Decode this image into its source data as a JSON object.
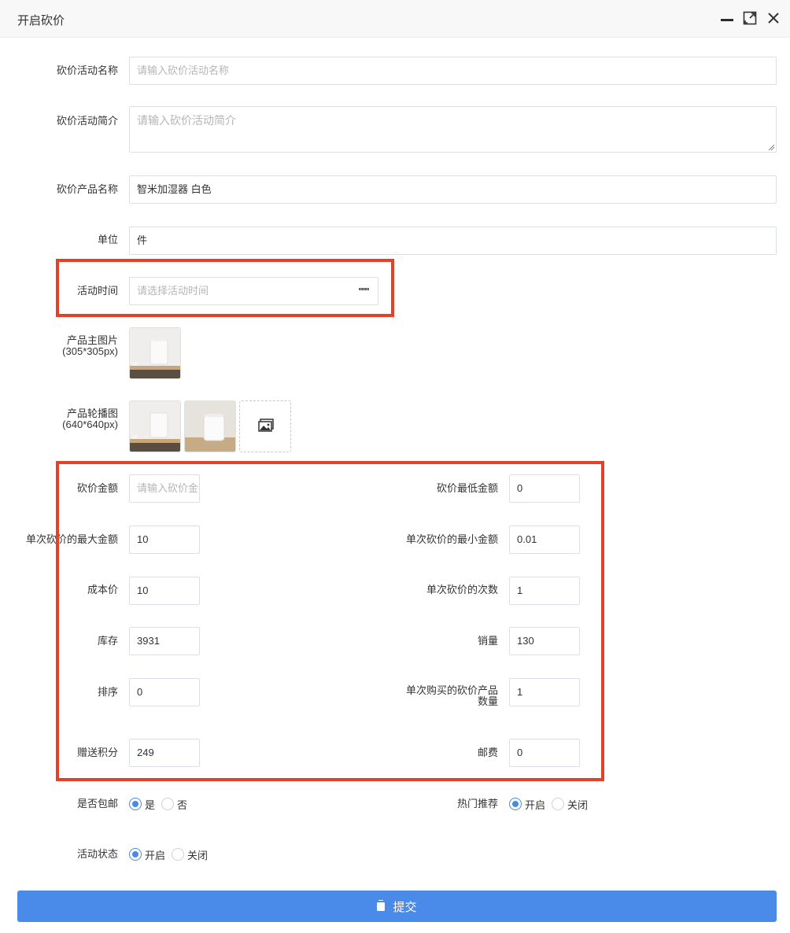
{
  "window": {
    "title": "开启砍价"
  },
  "form": {
    "activity_name": {
      "label": "砍价活动名称",
      "placeholder": "请输入砍价活动名称",
      "value": ""
    },
    "activity_intro": {
      "label": "砍价活动简介",
      "placeholder": "请输入砍价活动简介",
      "value": ""
    },
    "product_name": {
      "label": "砍价产品名称",
      "value": "智米加湿器 白色"
    },
    "unit": {
      "label": "单位",
      "value": "件"
    },
    "activity_time": {
      "label": "活动时间",
      "placeholder": "请选择活动时间",
      "icon": "dots-icon"
    },
    "main_image": {
      "label": "产品主图片",
      "sub_label": "(305*305px)"
    },
    "carousel": {
      "label": "产品轮播图",
      "sub_label": "(640*640px)"
    },
    "bargain_amount": {
      "label": "砍价金额",
      "placeholder": "请输入砍价金额",
      "value": ""
    },
    "bargain_min_amount": {
      "label": "砍价最低金额",
      "value": "0"
    },
    "max_per_cut": {
      "label": "单次砍价的最大金额",
      "value": "10"
    },
    "min_per_cut": {
      "label": "单次砍价的最小金额",
      "value": "0.01"
    },
    "cost_price": {
      "label": "成本价",
      "value": "10"
    },
    "cut_times": {
      "label": "单次砍价的次数",
      "value": "1"
    },
    "stock": {
      "label": "库存",
      "value": "3931"
    },
    "sales": {
      "label": "销量",
      "value": "130"
    },
    "sort": {
      "label": "排序",
      "value": "0"
    },
    "buy_qty": {
      "label_line1": "单次购买的砍价产品",
      "label_line2": "数量",
      "value": "1"
    },
    "points": {
      "label": "赠送积分",
      "value": "249"
    },
    "postage": {
      "label": "邮费",
      "value": "0"
    },
    "free_shipping": {
      "label": "是否包邮",
      "options": [
        "是",
        "否"
      ],
      "selected": "是"
    },
    "hot_recommend": {
      "label": "热门推荐",
      "options": [
        "开启",
        "关闭"
      ],
      "selected": "开启"
    },
    "status": {
      "label": "活动状态",
      "options": [
        "开启",
        "关闭"
      ],
      "selected": "开启"
    },
    "submit_label": "提交"
  },
  "colors": {
    "accent": "#4a8ae8",
    "highlight_box": "#e54126"
  }
}
